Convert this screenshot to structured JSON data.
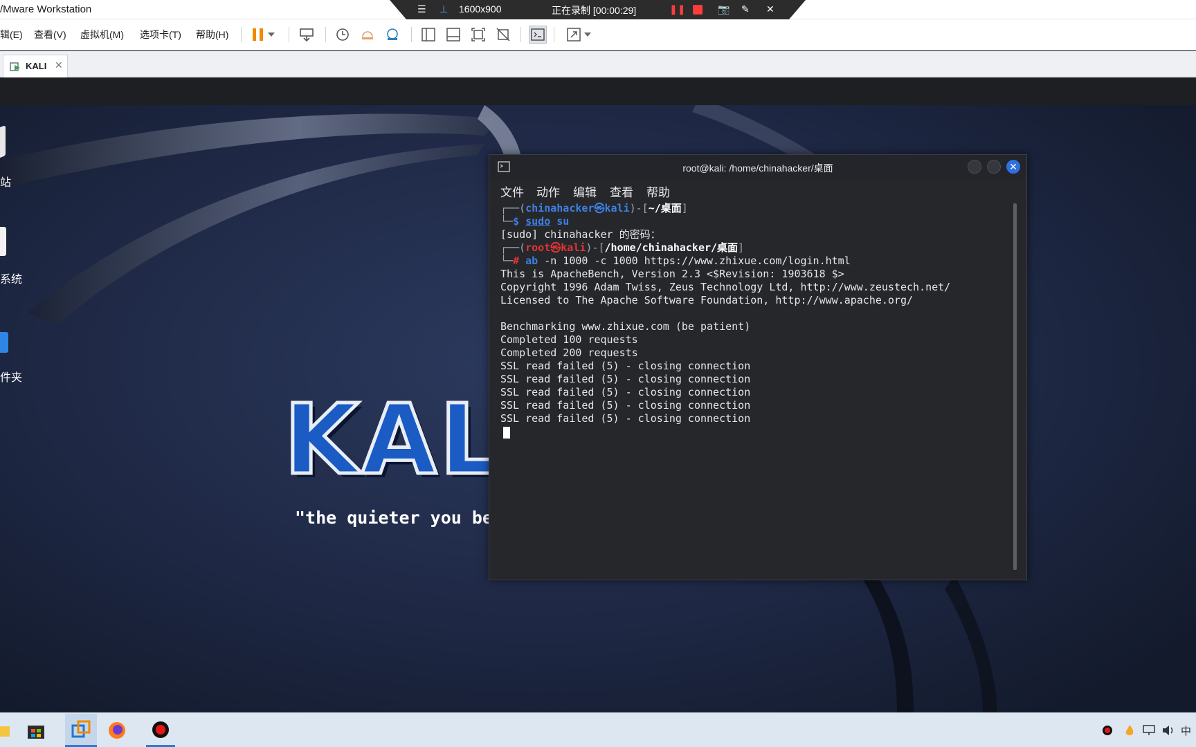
{
  "app": {
    "title": "/Mware Workstation"
  },
  "recording": {
    "resolution": "1600x900",
    "status": "正在录制 [00:00:29]"
  },
  "menu": {
    "items": [
      "辑(E)",
      "查看(V)",
      "虚拟机(M)",
      "选项卡(T)",
      "帮助(H)"
    ]
  },
  "tabs": [
    {
      "label": "KALI"
    }
  ],
  "desktop": {
    "icons": [
      {
        "label": "站"
      },
      {
        "label": "系统"
      },
      {
        "label": "件夹"
      }
    ],
    "logo_text": "KALI LINUX",
    "tagline": "\"the quieter you become, the more you are able to hear\""
  },
  "terminal": {
    "title": "root@kali: /home/chinahacker/桌面",
    "menu": [
      "文件",
      "动作",
      "编辑",
      "查看",
      "帮助"
    ],
    "prompt1": {
      "user": "chinahacker",
      "at": "㉿",
      "host": "kali",
      "path": "~/桌面"
    },
    "cmd1": {
      "sym": "$",
      "cmd": "sudo",
      "arg": "su"
    },
    "sudo_line": "[sudo] chinahacker 的密码：",
    "prompt2": {
      "user": "root",
      "at": "㉿",
      "host": "kali",
      "path": "/home/chinahacker/桌面"
    },
    "cmd2": {
      "sym": "#",
      "cmd": "ab",
      "args": "-n 1000 -c 1000 https://www.zhixue.com/login.html"
    },
    "output": [
      "This is ApacheBench, Version 2.3 <$Revision: 1903618 $>",
      "Copyright 1996 Adam Twiss, Zeus Technology Ltd, http://www.zeustech.net/",
      "Licensed to The Apache Software Foundation, http://www.apache.org/",
      "",
      "Benchmarking www.zhixue.com (be patient)",
      "Completed 100 requests",
      "Completed 200 requests",
      "SSL read failed (5) - closing connection",
      "SSL read failed (5) - closing connection",
      "SSL read failed (5) - closing connection",
      "SSL read failed (5) - closing connection",
      "SSL read failed (5) - closing connection"
    ]
  },
  "taskbar": {
    "tray_lang": "中"
  }
}
